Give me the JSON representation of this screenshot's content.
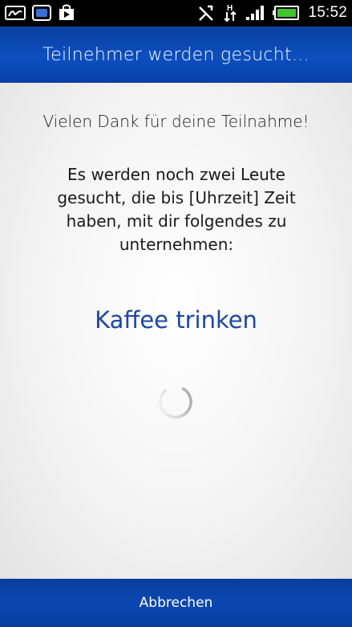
{
  "status_bar": {
    "time": "15:52",
    "left_icons": [
      "signature-icon",
      "app-icon",
      "play-store-icon"
    ],
    "right_icons": [
      "no-sync-icon",
      "data-transfer-icon",
      "signal-icon",
      "battery-icon"
    ],
    "network_label": "H"
  },
  "header": {
    "title": "Teilnehmer werden gesucht..."
  },
  "content": {
    "thanks": "Vielen Dank für deine Teilnahme!",
    "info": "Es werden noch zwei Leute gesucht, die bis [Uhrzeit] Zeit haben, mit dir folgendes zu unternehmen:",
    "activity": "Kaffee trinken"
  },
  "footer": {
    "cancel_label": "Abbrechen"
  },
  "colors": {
    "header_blue": "#0c4fc0",
    "activity_blue": "#1b47a8",
    "battery_green": "#3fc62a"
  }
}
